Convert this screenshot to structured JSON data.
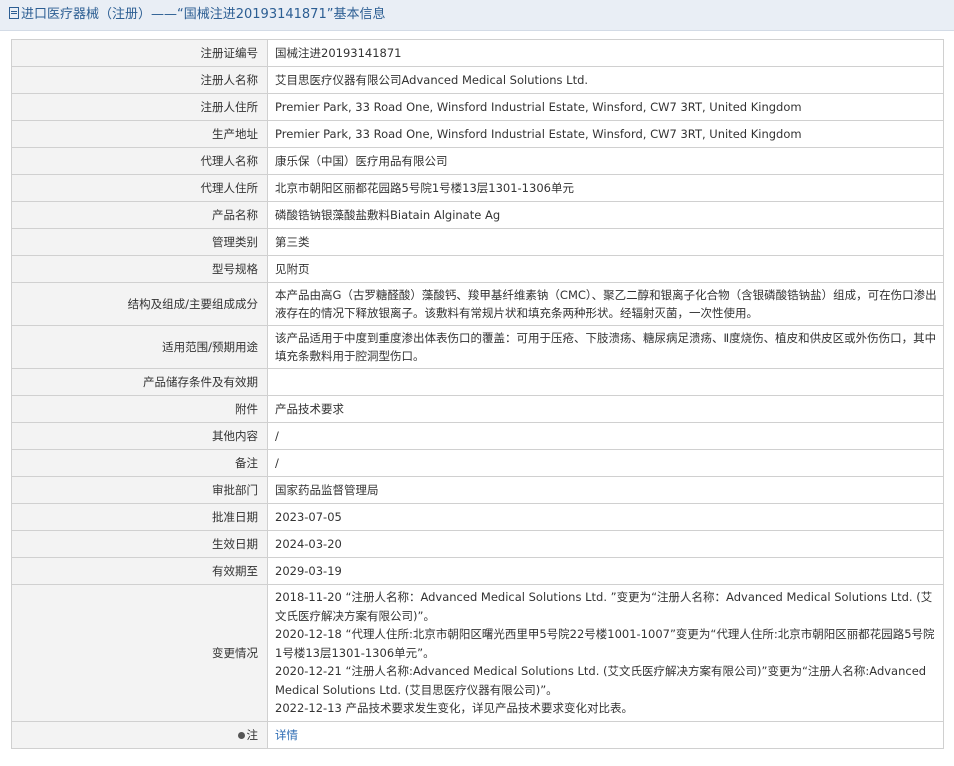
{
  "header": {
    "title": "进口医疗器械（注册）——“国械注进20193141871”基本信息"
  },
  "rows": [
    {
      "label": "注册证编号",
      "value": "国械注进20193141871"
    },
    {
      "label": "注册人名称",
      "value": "艾目思医疗仪器有限公司Advanced Medical Solutions Ltd."
    },
    {
      "label": "注册人住所",
      "value": "Premier Park, 33 Road One, Winsford Industrial Estate, Winsford, CW7 3RT, United Kingdom"
    },
    {
      "label": "生产地址",
      "value": "Premier Park, 33 Road One, Winsford Industrial Estate, Winsford, CW7 3RT, United Kingdom"
    },
    {
      "label": "代理人名称",
      "value": "康乐保（中国）医疗用品有限公司"
    },
    {
      "label": "代理人住所",
      "value": "北京市朝阳区丽都花园路5号院1号楼13层1301-1306单元"
    },
    {
      "label": "产品名称",
      "value": "磷酸锆钠银藻酸盐敷料Biatain Alginate Ag"
    },
    {
      "label": "管理类别",
      "value": "第三类"
    },
    {
      "label": "型号规格",
      "value": "见附页"
    },
    {
      "label": "结构及组成/主要组成成分",
      "value": "本产品由高G（古罗糖醛酸）藻酸钙、羧甲基纤维素钠（CMC）、聚乙二醇和银离子化合物（含银磷酸锆钠盐）组成，可在伤口渗出液存在的情况下释放银离子。该敷料有常规片状和填充条两种形状。经辐射灭菌，一次性使用。"
    },
    {
      "label": "适用范围/预期用途",
      "value": "该产品适用于中度到重度渗出体表伤口的覆盖：可用于压疮、下肢溃疡、糖尿病足溃疡、Ⅱ度烧伤、植皮和供皮区或外伤伤口，其中填充条敷料用于腔洞型伤口。"
    },
    {
      "label": "产品储存条件及有效期",
      "value": ""
    },
    {
      "label": "附件",
      "value": "产品技术要求"
    },
    {
      "label": "其他内容",
      "value": "/"
    },
    {
      "label": "备注",
      "value": "/"
    },
    {
      "label": "审批部门",
      "value": "国家药品监督管理局"
    },
    {
      "label": "批准日期",
      "value": "2023-07-05"
    },
    {
      "label": "生效日期",
      "value": "2024-03-20"
    },
    {
      "label": "有效期至",
      "value": "2029-03-19"
    }
  ],
  "changes": {
    "label": "变更情况",
    "entries": [
      "2018-11-20 “注册人名称：Advanced Medical Solutions Ltd. ”变更为“注册人名称：Advanced Medical Solutions Ltd. (艾文氏医疗解决方案有限公司)”。",
      "2020-12-18 “代理人住所:北京市朝阳区曙光西里甲5号院22号楼1001-1007”变更为“代理人住所:北京市朝阳区丽都花园路5号院1号楼13层1301-1306单元”。",
      "2020-12-21 “注册人名称:Advanced Medical Solutions Ltd. (艾文氏医疗解决方案有限公司)”变更为“注册人名称:Advanced Medical Solutions Ltd. (艾目思医疗仪器有限公司)”。",
      "2022-12-13 产品技术要求发生变化，详见产品技术要求变化对比表。"
    ]
  },
  "note": {
    "label": "注",
    "link_text": "详情"
  }
}
